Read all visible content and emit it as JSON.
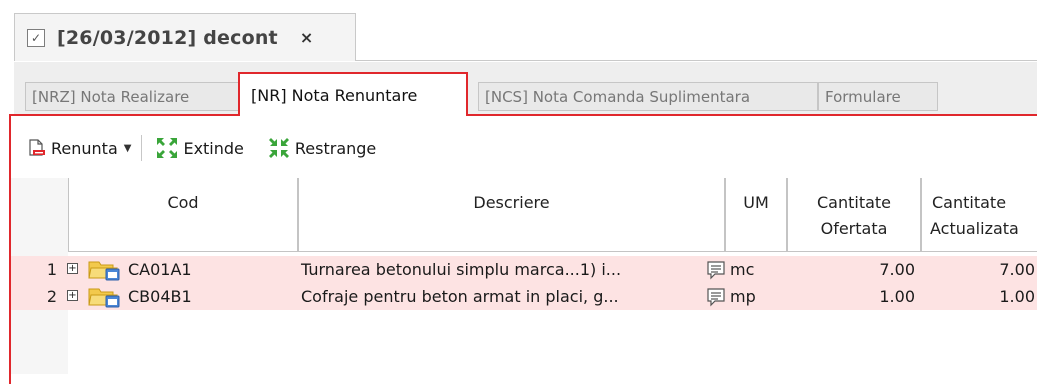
{
  "document_tab": {
    "title": "[26/03/2012] decont",
    "close_glyph": "×",
    "check_glyph": "✓"
  },
  "subtabs": [
    {
      "label": "[NRZ] Nota Realizare",
      "active": false
    },
    {
      "label": "[NR] Nota Renuntare",
      "active": true
    },
    {
      "label": "[NCS] Nota Comanda Suplimentara",
      "active": false
    },
    {
      "label": "Formulare",
      "active": false
    }
  ],
  "toolbar": {
    "renunta_label": "Renunta",
    "extinde_label": "Extinde",
    "restrange_label": "Restrange"
  },
  "grid": {
    "columns": {
      "cod": "Cod",
      "descriere": "Descriere",
      "um": "UM",
      "cantitate_ofertata_line1": "Cantitate",
      "cantitate_ofertata_line2": "Ofertata",
      "cantitate_actualizata_line1": "Cantitate",
      "cantitate_actualizata_line2": "Actualizata"
    },
    "rows": [
      {
        "num": "1",
        "expander": "+",
        "cod": "CA01A1",
        "descriere": "Turnarea betonului simplu marca...1) i...",
        "um": "mc",
        "cant_ofertata": "7.00",
        "cant_actualizata": "7.00"
      },
      {
        "num": "2",
        "expander": "+",
        "cod": "CB04B1",
        "descriere": "Cofraje pentru beton armat in placi, g...",
        "um": "mp",
        "cant_ofertata": "1.00",
        "cant_actualizata": "1.00"
      }
    ]
  },
  "colors": {
    "accent_red": "#e0272c",
    "row_highlight": "#fde3e3",
    "folder_yellow": "#f2c94c",
    "green_icon": "#3aa53a"
  }
}
